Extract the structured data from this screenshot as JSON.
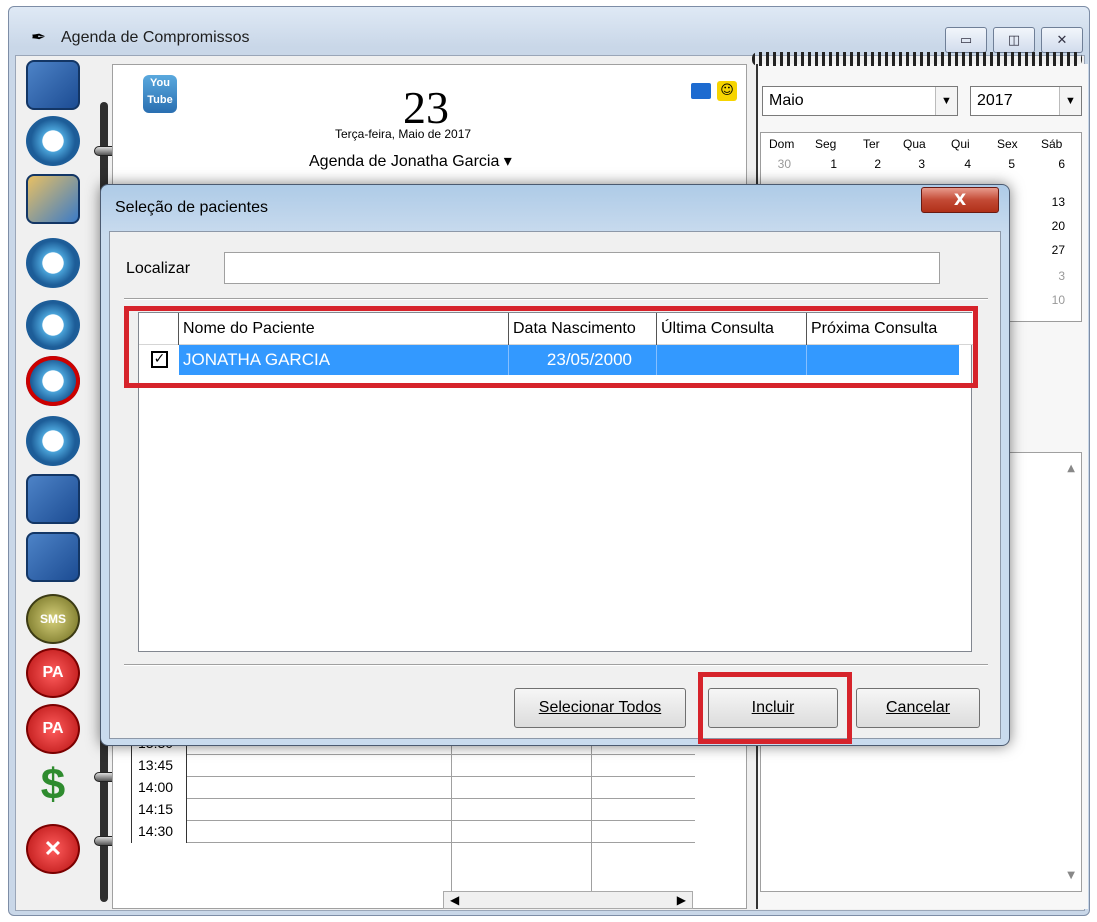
{
  "window": {
    "title": "Agenda de Compromissos",
    "minimize_icon": "minimize-icon",
    "restore_icon": "restore-icon",
    "close_icon": "close-icon"
  },
  "toolbar": {
    "items": [
      {
        "name": "contacts-book-icon"
      },
      {
        "name": "appointments-clock-icon"
      },
      {
        "name": "books-icon"
      },
      {
        "name": "schedule-book-icon"
      },
      {
        "name": "multi-clock-icon"
      },
      {
        "name": "delete-appointment-icon"
      },
      {
        "name": "add-appointment-icon"
      },
      {
        "name": "lock-book-icon"
      },
      {
        "name": "lock-book-2-icon"
      },
      {
        "name": "sms-icon",
        "label": "SMS"
      },
      {
        "name": "pa-icon",
        "label": "PA"
      },
      {
        "name": "pa-cancel-icon",
        "label": "PA"
      },
      {
        "name": "dollar-icon",
        "label": "$"
      },
      {
        "name": "exit-icon",
        "label": "✕"
      }
    ]
  },
  "agenda": {
    "youtube_label": "You\nTube",
    "day_number": "23",
    "day_line": "Terça-feira, Maio de 2017",
    "agenda_of": "Agenda de Jonatha Garcia ▾",
    "times": [
      "13:30",
      "13:45",
      "14:00",
      "14:15",
      "14:30"
    ]
  },
  "calendar": {
    "month": "Maio",
    "year": "2017",
    "weekdays": [
      "Dom",
      "Seg",
      "Ter",
      "Qua",
      "Qui",
      "Sex",
      "Sáb"
    ],
    "first_row": [
      "30",
      "1",
      "2",
      "3",
      "4",
      "5",
      "6"
    ],
    "visible_right_days": [
      "13",
      "20",
      "27",
      "3",
      "10"
    ]
  },
  "dialog": {
    "title": "Seleção de pacientes",
    "close_label": "X",
    "find_label": "Localizar",
    "find_value": "",
    "columns": [
      "Nome do Paciente",
      "Data Nascimento",
      "Última Consulta",
      "Próxima Consulta"
    ],
    "rows": [
      {
        "checked": true,
        "name": "JONATHA GARCIA",
        "birth": "23/05/2000",
        "last": "",
        "next": ""
      }
    ],
    "buttons": {
      "select_all": "Selecionar Todos",
      "include": "Incluir",
      "cancel": "Cancelar"
    }
  },
  "colors": {
    "selection": "#3399ff",
    "highlight": "#d6232b"
  }
}
